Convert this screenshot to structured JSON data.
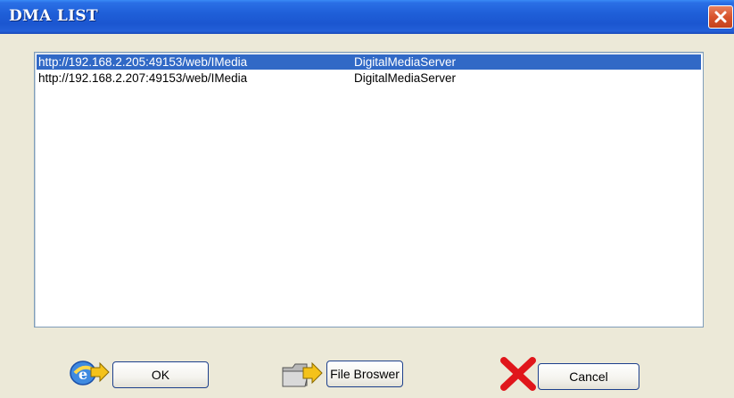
{
  "window": {
    "title": "DMA LIST"
  },
  "list": {
    "items": [
      {
        "url": "http://192.168.2.205:49153/web/IMedia",
        "name": "DigitalMediaServer",
        "selected": true
      },
      {
        "url": "http://192.168.2.207:49153/web/IMedia",
        "name": "DigitalMediaServer",
        "selected": false
      }
    ]
  },
  "buttons": {
    "ok_label": "OK",
    "browse_label": "File Broswer",
    "cancel_label": "Cancel"
  },
  "icons": {
    "ok": "ie-globe-arrow-icon",
    "browse": "folder-arrow-icon",
    "cancel": "red-x-icon",
    "close": "close-icon"
  },
  "colors": {
    "titlebar": "#1f5fd8",
    "selection": "#3169c6",
    "close": "#d8532c",
    "cancel_x": "#e0161b"
  }
}
